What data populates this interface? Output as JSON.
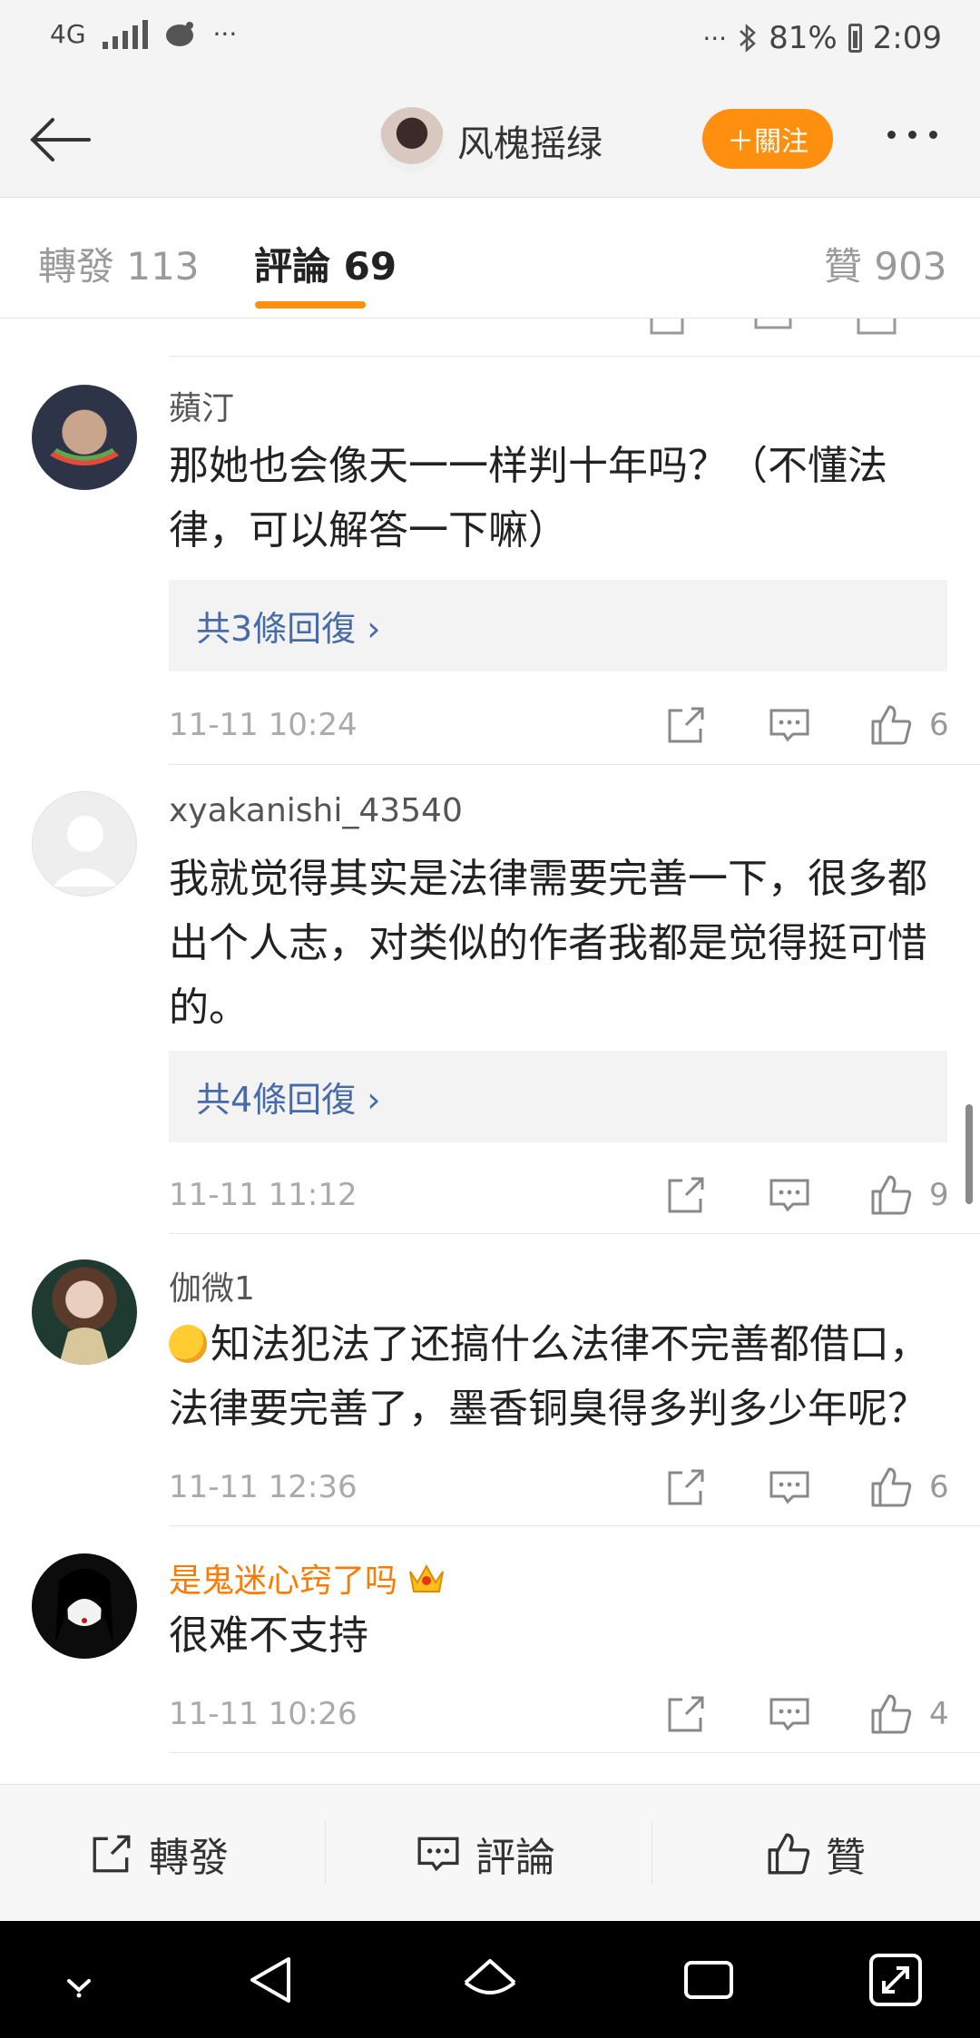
{
  "status_bar": {
    "network": "4G",
    "dots_left": "···",
    "dots_right": "···",
    "battery": "81%",
    "time": "2:09"
  },
  "header": {
    "username": "风槐摇绿",
    "follow_label": "＋關注"
  },
  "tabs": [
    {
      "label": "轉發 113"
    },
    {
      "label": "評論 69"
    },
    {
      "label": "贊 903"
    }
  ],
  "comments": [
    {
      "user": "蘋汀",
      "text": "那她也会像天一一样判十年吗？（不懂法律，可以解答一下嘛）",
      "replies": "共3條回復 ›",
      "time": "11-11 10:24",
      "likes": "6"
    },
    {
      "user": "xyakanishi_43540",
      "text": "我就觉得其实是法律需要完善一下，很多都出个人志，对类似的作者我都是觉得挺可惜的。",
      "replies": "共4條回復 ›",
      "time": "11-11 11:12",
      "likes": "9"
    },
    {
      "user": "伽微1",
      "text": "知法犯法了还搞什么法律不完善都借口，法律要完善了，墨香铜臭得多判多少年呢？",
      "time": "11-11 12:36",
      "likes": "6",
      "emoji": "thinking-face-emoji"
    },
    {
      "user": "是鬼迷心窍了吗",
      "text": "很难不支持",
      "time": "11-11 10:26",
      "likes": "4",
      "badge": "crown-icon"
    }
  ],
  "bottom_bar": {
    "repost": "轉發",
    "comment": "評論",
    "like": "贊"
  },
  "colors": {
    "accent": "#ff8f0f",
    "link": "#476aa8",
    "vip_name": "#ff7a00"
  }
}
